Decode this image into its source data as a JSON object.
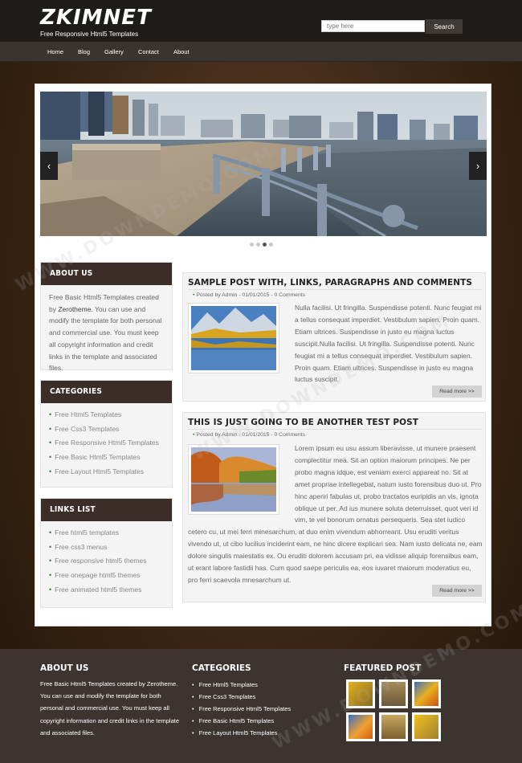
{
  "header": {
    "logo": "ZKIMNET",
    "tagline": "Free Responsive Html5 Templates",
    "search_placeholder": "type here",
    "search_button": "Search"
  },
  "nav": {
    "items": [
      "Home",
      "Blog",
      "Gallery",
      "Contact",
      "About"
    ]
  },
  "sidebar": {
    "about": {
      "title": "ABOUT US",
      "text_before": "Free Basic Html5 Templates created by ",
      "link": "Zerotheme",
      "text_after": ". You can use and modify the template for both personal and commercial use. You must keep all copyright information and credit links in the template and associated files."
    },
    "categories": {
      "title": "CATEGORIES",
      "items": [
        "Free Html5 Templates",
        "Free Css3 Templates",
        "Free Responsive Html5 Templates",
        "Free Basic Html5 Templates",
        "Free Layout Html5 Templates"
      ]
    },
    "links": {
      "title": "LINKS LIST",
      "items": [
        "Free html5 templates",
        "Free css3 menus",
        "Free responsive html5 themes",
        "Free onepage html5 themes",
        "Free animated html5 themes"
      ]
    }
  },
  "posts": [
    {
      "title": "SAMPLE POST WITH, LINKS, PARAGRAPHS AND COMMENTS",
      "meta": "Posted by Admin - 01/01/2015 - 0 Comments",
      "text": "Nulla facilisi. Ut fringilla. Suspendisse potenti. Nunc feugiat mi a tellus consequat imperdiet. Vestibulum sapien. Proin quam. Etiam ultrices. Suspendisse in justo eu magna luctus suscipit.Nulla facilisi. Ut fringilla. Suspendisse potenti. Nunc feugiat mi a tellus consequat imperdiet. Vestibulum sapien. Proin quam. Etiam ultrices. Suspendisse in justo eu magna luctus suscipit.",
      "readmore": "Read more >>"
    },
    {
      "title": "THIS IS JUST GOING TO BE ANOTHER TEST POST",
      "meta": "Posted by Admin - 01/01/2015 - 0 Comments",
      "text_beside": "Lorem ipsum eu usu assum liberavisse, ut munere praesent complectitur mea. Sit an option maiorum principes. Ne per probo magna idque, est veniam exerci appareat no. Sit at amet propriae intellegebat, natum iusto forensibus duo ut. Pro hinc aperiri fabulas ut, probo tractatos euripidis an vis, ignota oblique ut per. Ad ius munere soluta deterruisset, quot veri id vim, te vel bonorum ornatus persequeris. Sea stet iudico",
      "text_below": "cetero cu, ut mei ferri minesarchum, at duo enim vivendum abhorreant. Usu eruditi veritus vivendo ut, ut cibo lucilius inciderint eam, ne hinc dicere explicari sea. Nam iusto delicata ne, eam dolore singulis maiestatis ex. Ou eruditi dolorem accusam pri, ea vidisse aliquip forensibus eam, ut erant labore fastidii has. Cum quod saepe periculis ea, eos iuvaret maiorum moderatius eu, pro ferri scaevola mnesarchum ut.",
      "readmore": "Read more >>"
    }
  ],
  "footer": {
    "about": {
      "title": "ABOUT US",
      "text_before": "Free Basic Html5 Templates created by ",
      "link": "Zerotheme",
      "text_after": ". You can use and modify the template for both personal and commercial use. You must keep all copyright information and credit links in the template and associated files."
    },
    "categories": {
      "title": "CATEGORIES",
      "items": [
        "Free Html5 Templates",
        "Free Css3 Templates",
        "Free Responsive Html5 Templates",
        "Free Basic Html5 Templates",
        "Free Layout Html5 Templates"
      ]
    },
    "featured": {
      "title": "FEATURED POST"
    }
  },
  "slider": {
    "prev": "‹",
    "next": "›",
    "active_dot": 3,
    "dot_count": 4
  },
  "watermark": "WWW.DOWNDEMO.COM",
  "colors": {
    "title_bar": "#3b2e28",
    "header_bg": "#1f1b18",
    "footer_bg": "#3d3430",
    "bullet": "#2a8a2a"
  }
}
